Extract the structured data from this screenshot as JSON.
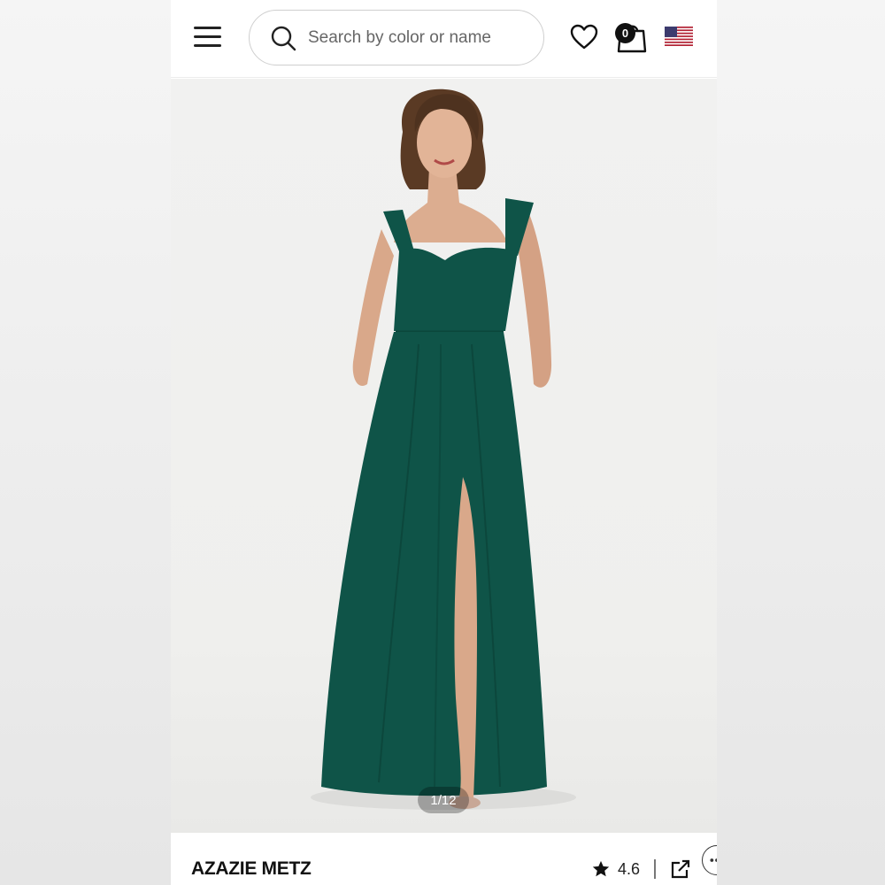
{
  "header": {
    "search_placeholder": "Search by color or name",
    "bag_count": "0",
    "icons": [
      "menu-icon",
      "search-icon",
      "heart-icon",
      "shopping-bag-icon",
      "us-flag-icon"
    ]
  },
  "gallery": {
    "pager": "1/12",
    "dress_color": "#0f5448"
  },
  "product": {
    "title": "AZAZIE METZ",
    "rating": "4.6"
  },
  "colors": {
    "accent": "#111111",
    "border": "#cfcfcf"
  }
}
